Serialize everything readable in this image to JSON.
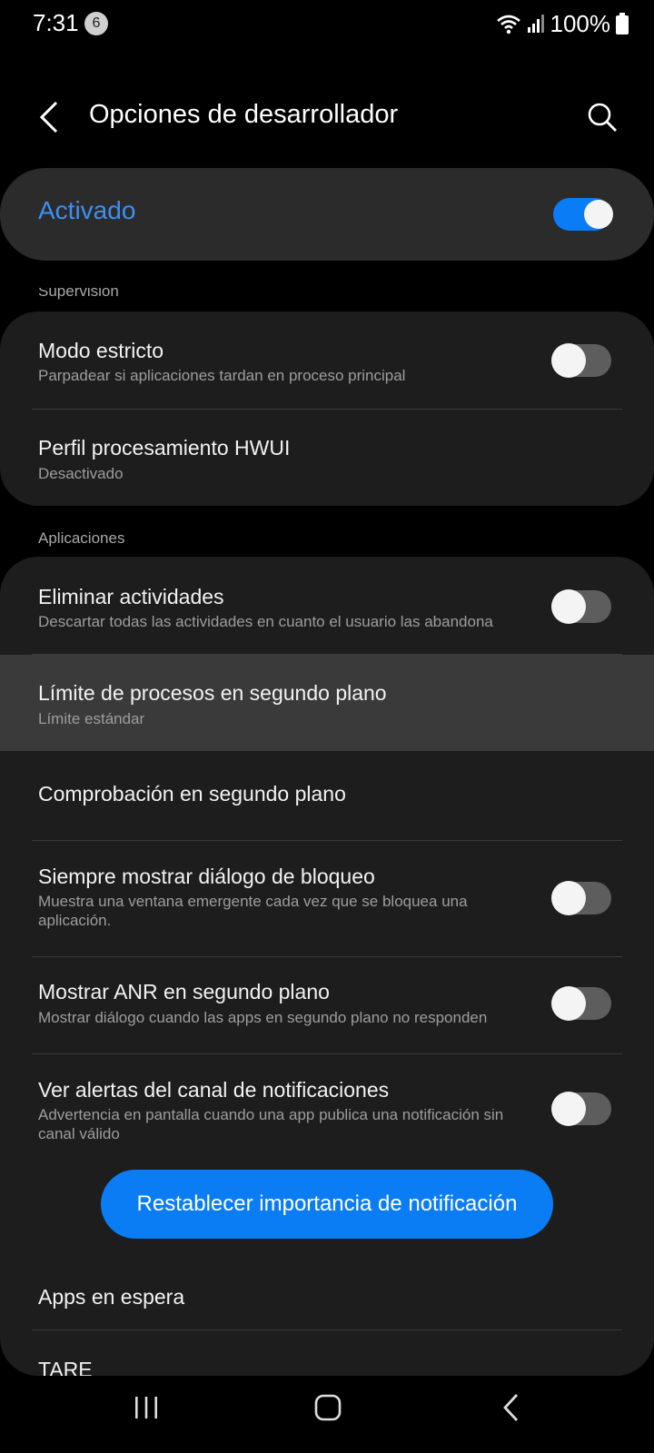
{
  "status_bar": {
    "time": "7:31",
    "notification_count": "6",
    "battery": "100%"
  },
  "header": {
    "title": "Opciones de desarrollador"
  },
  "master_switch": {
    "label": "Activado",
    "state": "on",
    "accent_color": "#3e8ff1"
  },
  "sections": {
    "supervision": {
      "header": "Supervisión",
      "items": [
        {
          "title": "Modo estricto",
          "subtitle": "Parpadear si aplicaciones tardan en proceso principal",
          "toggle": "off"
        },
        {
          "title": "Perfil procesamiento HWUI",
          "subtitle": "Desactivado"
        }
      ]
    },
    "apps": {
      "header": "Aplicaciones",
      "items": [
        {
          "title": "Eliminar actividades",
          "subtitle": "Descartar todas las actividades en cuanto el usuario las abandona",
          "toggle": "off"
        },
        {
          "title": "Límite de procesos en segundo plano",
          "subtitle": "Límite estándar"
        },
        {
          "title": "Comprobación en segundo plano"
        },
        {
          "title": "Siempre mostrar diálogo de bloqueo",
          "subtitle": "Muestra una ventana emergente cada vez que se bloquea una aplicación.",
          "toggle": "off"
        },
        {
          "title": "Mostrar ANR en segundo plano",
          "subtitle": "Mostrar diálogo cuando las apps en segundo plano no responden",
          "toggle": "off"
        },
        {
          "title": "Ver alertas del canal de notificaciones",
          "subtitle": "Advertencia en pantalla cuando una app publica una notificación sin canal válido",
          "toggle": "off"
        },
        {
          "title": "Apps en espera"
        },
        {
          "title": "TARE"
        }
      ],
      "reset_button": "Restablecer importancia de notificación"
    }
  },
  "colors": {
    "background": "#000000",
    "card": "#1d1d1d",
    "primary_button": "#0b7df4"
  }
}
